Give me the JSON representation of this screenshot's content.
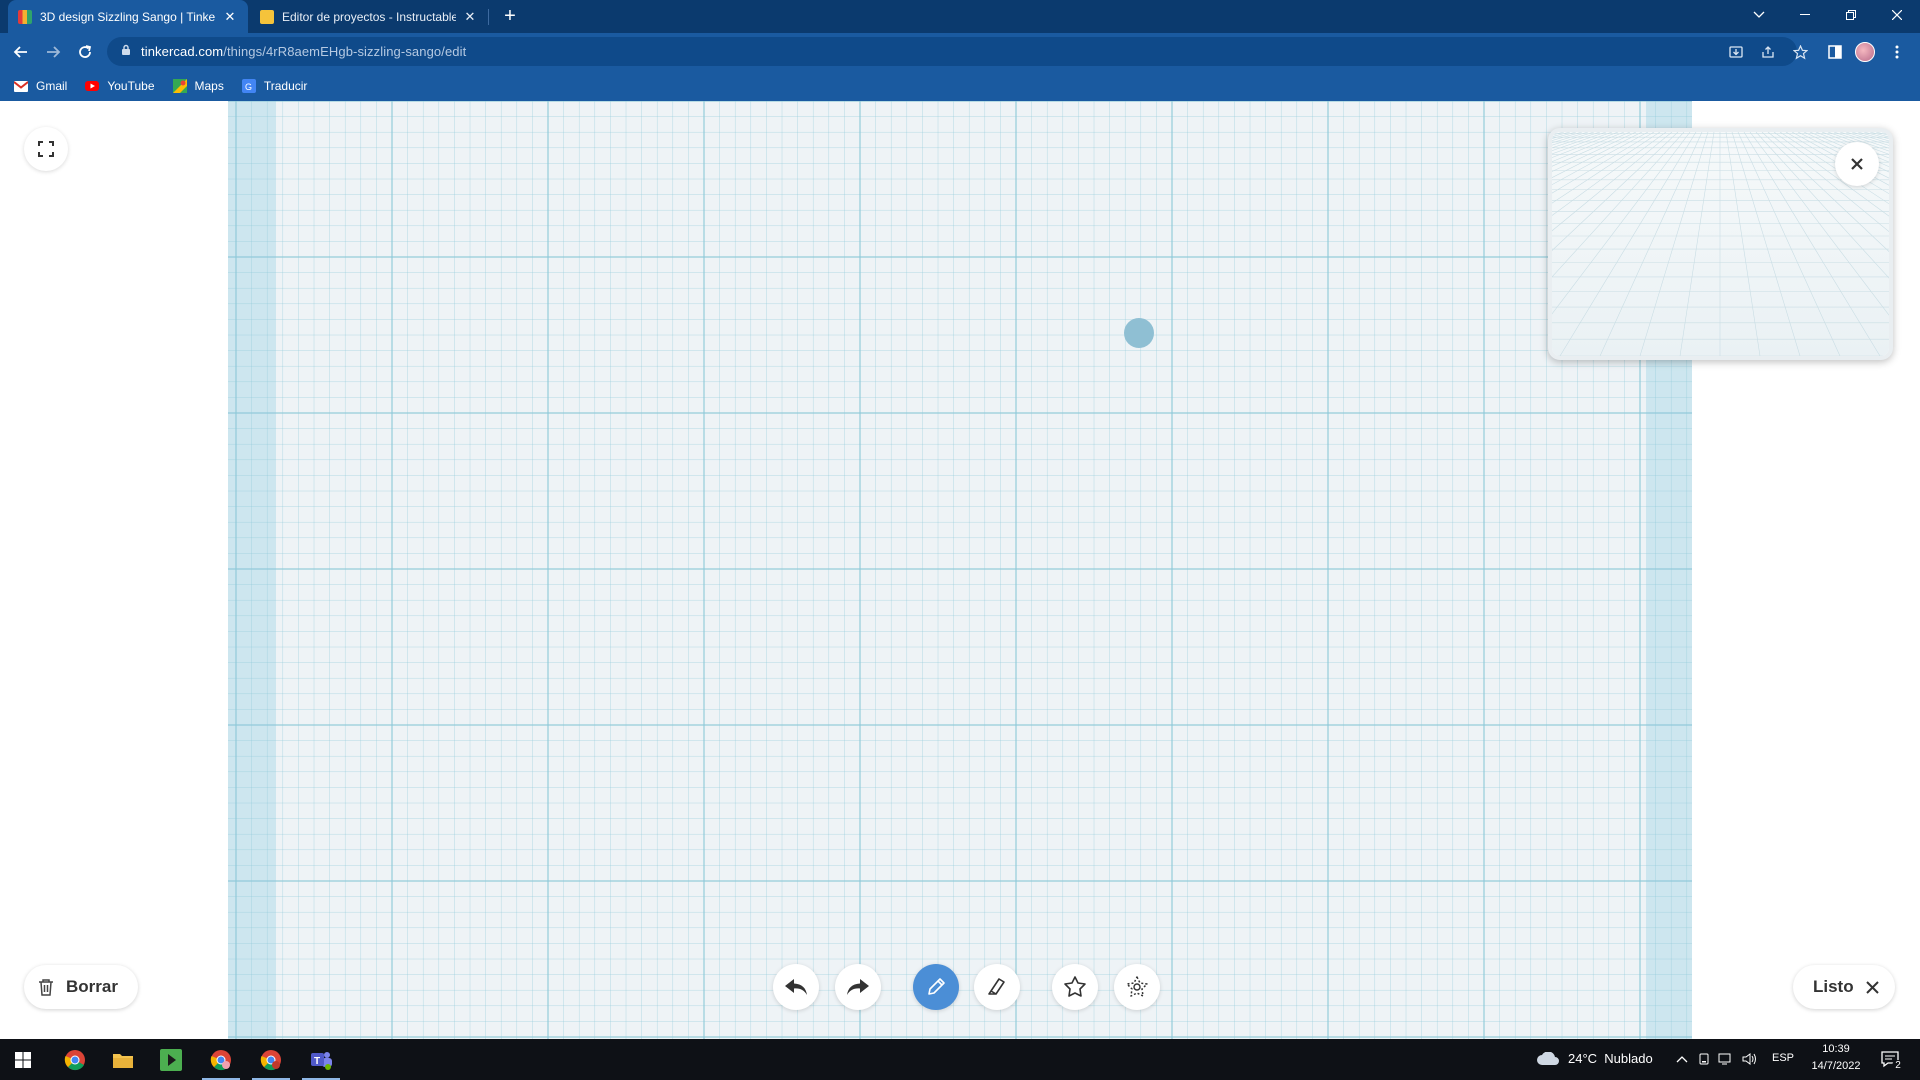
{
  "browser": {
    "tabs": [
      {
        "title": "3D design Sizzling Sango | Tinker",
        "active": true
      },
      {
        "title": "Editor de proyectos - Instructable",
        "active": false
      }
    ],
    "url": {
      "domain": "tinkercad.com",
      "path": "/things/4rR8aemEHgb-sizzling-sango/edit"
    },
    "bookmarks": [
      {
        "label": "Gmail",
        "icon": "gmail-icon"
      },
      {
        "label": "YouTube",
        "icon": "youtube-icon"
      },
      {
        "label": "Maps",
        "icon": "maps-icon"
      },
      {
        "label": "Traducir",
        "icon": "translate-icon"
      }
    ],
    "colors": {
      "tabbar": "#0b3a6e",
      "toolbar": "#1a5aa0"
    }
  },
  "editor": {
    "borrar_label": "Borrar",
    "listo_label": "Listo",
    "tools": [
      "undo-icon",
      "redo-icon",
      "pencil-icon",
      "eraser-icon",
      "shape-add-icon",
      "shape-subtract-icon"
    ],
    "active_tool": "pencil-icon",
    "colors": {
      "active_tool": "#4b8ed6",
      "grid_bg": "#eef3f6",
      "grid_line": "#8cc8d8",
      "edge_strip": "#cde6ef"
    }
  },
  "taskbar": {
    "weather": {
      "temp": "24°C",
      "condition": "Nublado"
    },
    "language": "ESP",
    "time": "10:39",
    "date": "14/7/2022",
    "notifications": "2"
  }
}
